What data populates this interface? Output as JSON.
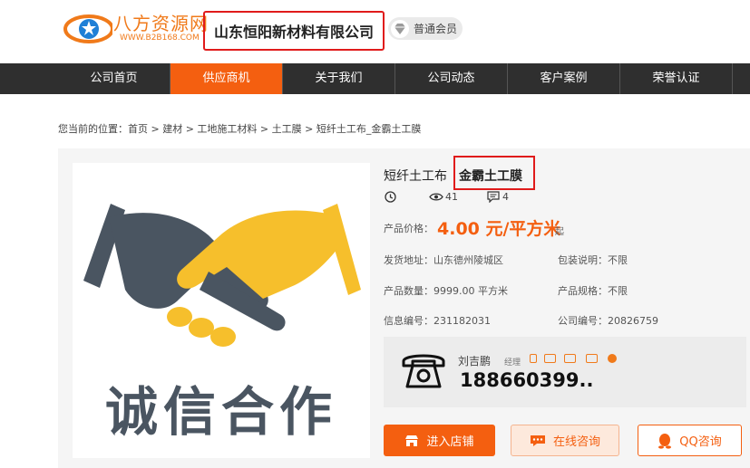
{
  "header": {
    "logo_text": "八方资源网",
    "logo_sub": "WWW.B2B168.COM",
    "company_name": "山东恒阳新材料有限公司",
    "member_label": "普通会员"
  },
  "nav": {
    "items": [
      {
        "label": "公司首页"
      },
      {
        "label": "供应商机"
      },
      {
        "label": "关于我们"
      },
      {
        "label": "公司动态"
      },
      {
        "label": "客户案例"
      },
      {
        "label": "荣誉认证"
      }
    ],
    "active_index": 1
  },
  "breadcrumb": "您当前的位置：首页 > 建材 > 工地施工材料 > 土工膜 > 短纤土工布_金霸土工膜",
  "product": {
    "image_text": "诚信合作",
    "title_main": "短纤土工布",
    "title_sub": "金霸土工膜",
    "views": "41",
    "comments": "4",
    "price_label": "产品价格：",
    "price": "4.00 元/平方米",
    "price_suffix": "起",
    "fields": {
      "ship_label": "发货地址：",
      "ship_value": "山东德州陵城区",
      "pack_label": "包装说明：",
      "pack_value": "不限",
      "qty_label": "产品数量：",
      "qty_value": "9999.00 平方米",
      "spec_label": "产品规格：",
      "spec_value": "不限",
      "info_label": "信息编号：",
      "info_value": "231182031",
      "co_label": "公司编号：",
      "co_value": "20826759"
    }
  },
  "contact": {
    "name": "刘吉鹏",
    "role": "经理",
    "phone": "188660399.."
  },
  "buttons": {
    "enter_store": "进入店铺",
    "online_consult": "在线咨询",
    "qq_consult": "QQ咨询"
  },
  "colors": {
    "accent": "#f45f10",
    "nav_bg": "#2f2f2f",
    "highlight_border": "#e01b1b",
    "handshake_dark": "#4a5561",
    "handshake_yellow": "#f6bf2c"
  }
}
